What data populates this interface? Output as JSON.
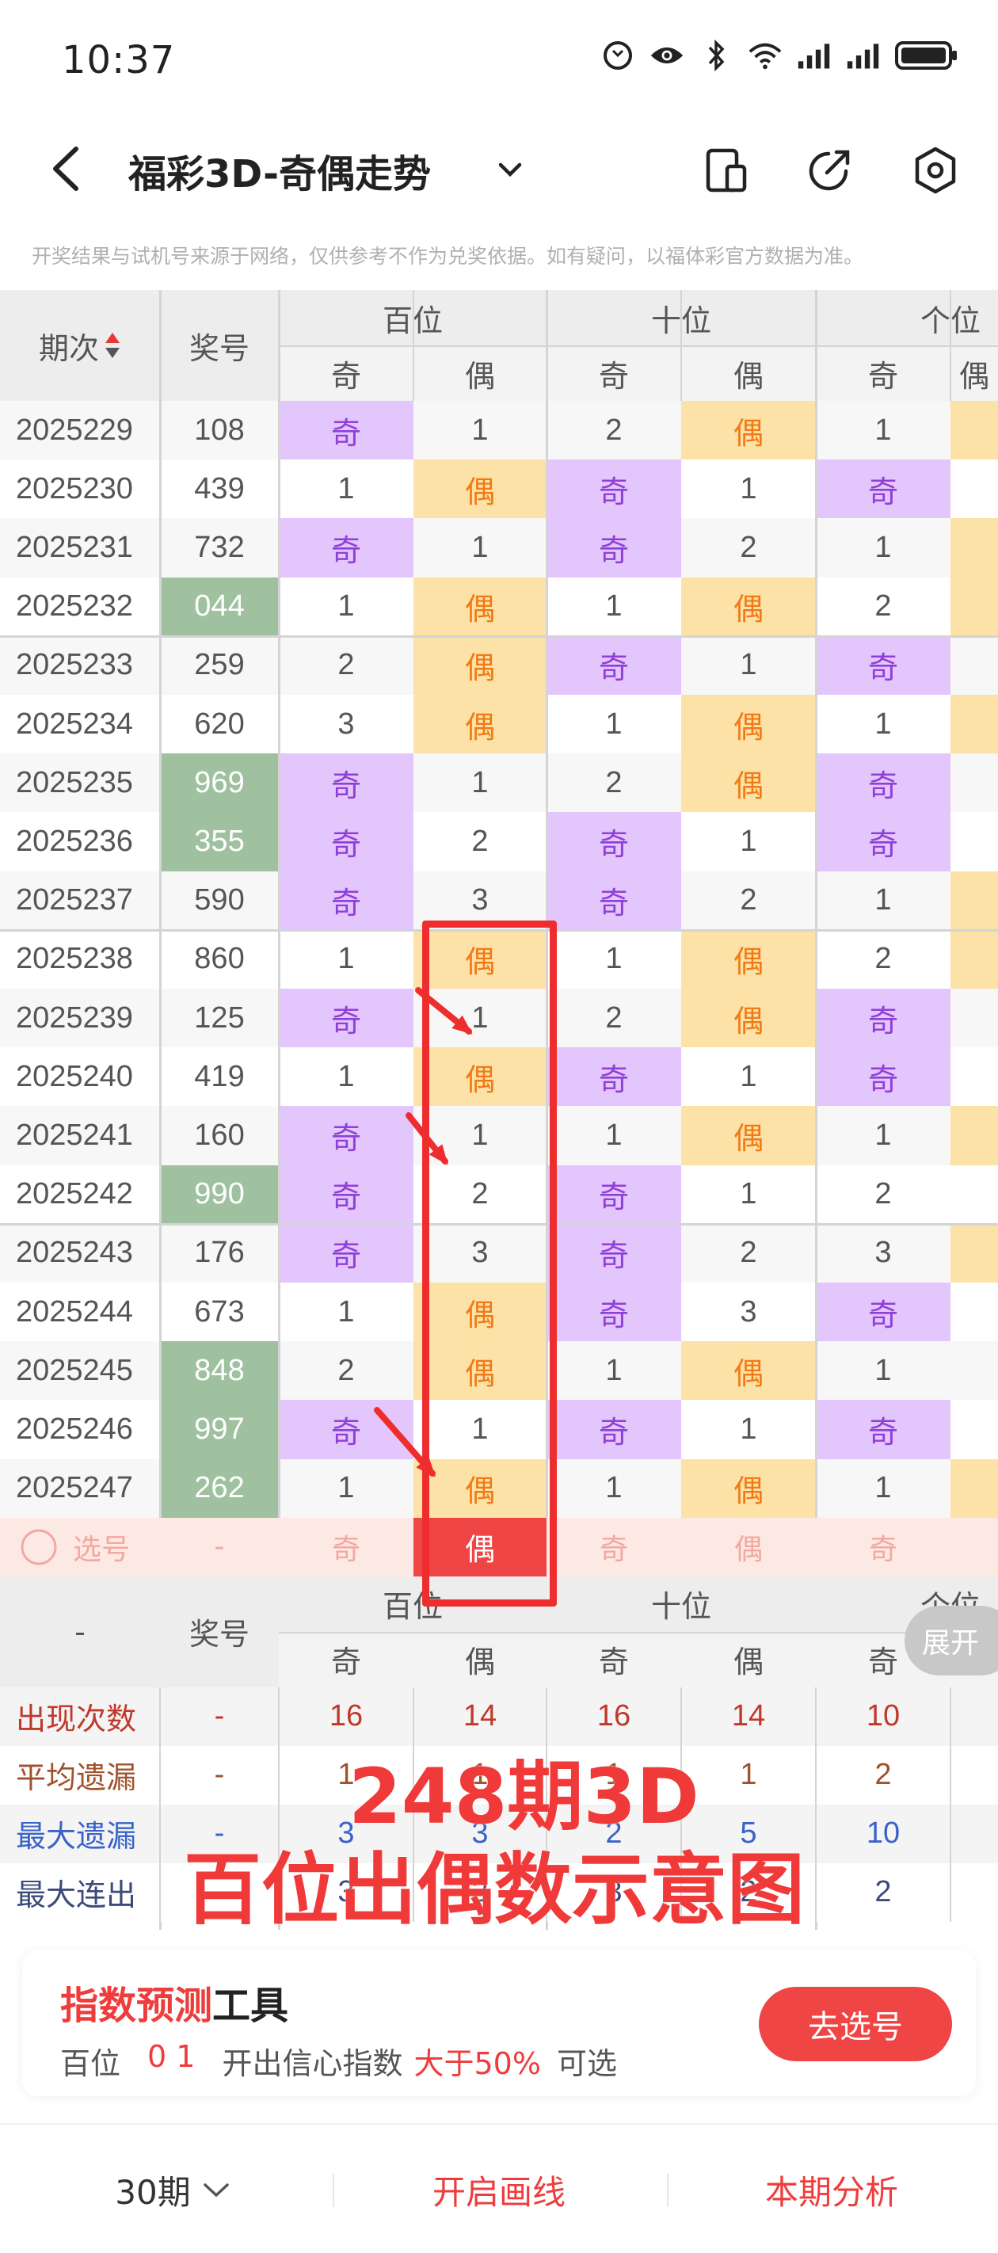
{
  "status": {
    "time": "10:37"
  },
  "header": {
    "title": "福彩3D-奇偶走势"
  },
  "disclaimer": "开奖结果与试机号来源于网络，仅供参考不作为兑奖依据。如有疑问，以福体彩官方数据为准。",
  "table": {
    "col_period": "期次",
    "col_prize": "奖号",
    "groups": [
      "百位",
      "十位",
      "个位"
    ],
    "sub_odd": "奇",
    "sub_even": "偶",
    "rows": [
      {
        "period": "2025229",
        "prize": "108",
        "green": false,
        "cells": [
          "奇",
          "1",
          "2",
          "偶",
          "1"
        ]
      },
      {
        "period": "2025230",
        "prize": "439",
        "green": false,
        "cells": [
          "1",
          "偶",
          "奇",
          "1",
          "奇"
        ]
      },
      {
        "period": "2025231",
        "prize": "732",
        "green": false,
        "cells": [
          "奇",
          "1",
          "奇",
          "2",
          "1"
        ]
      },
      {
        "period": "2025232",
        "prize": "044",
        "green": true,
        "cells": [
          "1",
          "偶",
          "1",
          "偶",
          "2"
        ]
      },
      {
        "period": "2025233",
        "prize": "259",
        "green": false,
        "cells": [
          "2",
          "偶",
          "奇",
          "1",
          "奇"
        ]
      },
      {
        "period": "2025234",
        "prize": "620",
        "green": false,
        "cells": [
          "3",
          "偶",
          "1",
          "偶",
          "1"
        ]
      },
      {
        "period": "2025235",
        "prize": "969",
        "green": true,
        "cells": [
          "奇",
          "1",
          "2",
          "偶",
          "奇"
        ]
      },
      {
        "period": "2025236",
        "prize": "355",
        "green": true,
        "cells": [
          "奇",
          "2",
          "奇",
          "1",
          "奇"
        ]
      },
      {
        "period": "2025237",
        "prize": "590",
        "green": false,
        "cells": [
          "奇",
          "3",
          "奇",
          "2",
          "1"
        ]
      },
      {
        "period": "2025238",
        "prize": "860",
        "green": false,
        "cells": [
          "1",
          "偶",
          "1",
          "偶",
          "2"
        ]
      },
      {
        "period": "2025239",
        "prize": "125",
        "green": false,
        "cells": [
          "奇",
          "1",
          "2",
          "偶",
          "奇"
        ]
      },
      {
        "period": "2025240",
        "prize": "419",
        "green": false,
        "cells": [
          "1",
          "偶",
          "奇",
          "1",
          "奇"
        ]
      },
      {
        "period": "2025241",
        "prize": "160",
        "green": false,
        "cells": [
          "奇",
          "1",
          "1",
          "偶",
          "1"
        ]
      },
      {
        "period": "2025242",
        "prize": "990",
        "green": true,
        "cells": [
          "奇",
          "2",
          "奇",
          "1",
          "2"
        ]
      },
      {
        "period": "2025243",
        "prize": "176",
        "green": false,
        "cells": [
          "奇",
          "3",
          "奇",
          "2",
          "3"
        ]
      },
      {
        "period": "2025244",
        "prize": "673",
        "green": false,
        "cells": [
          "1",
          "偶",
          "奇",
          "3",
          "奇"
        ]
      },
      {
        "period": "2025245",
        "prize": "848",
        "green": true,
        "cells": [
          "2",
          "偶",
          "1",
          "偶",
          "1"
        ]
      },
      {
        "period": "2025246",
        "prize": "997",
        "green": true,
        "cells": [
          "奇",
          "1",
          "奇",
          "1",
          "奇"
        ]
      },
      {
        "period": "2025247",
        "prize": "262",
        "green": true,
        "cells": [
          "1",
          "偶",
          "1",
          "偶",
          "1"
        ]
      }
    ],
    "select_row": {
      "label": "选号",
      "prize": "-",
      "cells": [
        "奇",
        "偶",
        "奇",
        "偶",
        "奇"
      ],
      "active_index": 1
    },
    "footer_header": {
      "period": "-",
      "prize": "奖号"
    },
    "stats": [
      {
        "label": "出现次数",
        "color": "#c0392b",
        "prize": "-",
        "values": [
          "16",
          "14",
          "16",
          "14",
          "10"
        ]
      },
      {
        "label": "平均遗漏",
        "color": "#a0522d",
        "prize": "-",
        "values": [
          "1",
          "1",
          "1",
          "1",
          "2"
        ]
      },
      {
        "label": "最大遗漏",
        "color": "#3a63c7",
        "prize": "-",
        "values": [
          "3",
          "3",
          "2",
          "5",
          "10"
        ]
      },
      {
        "label": "最大连出",
        "color": "#3a4a7a",
        "prize": "-",
        "values": [
          "3",
          "3",
          "3",
          "2",
          "2"
        ]
      }
    ],
    "expand_label": "展开"
  },
  "annotation": {
    "line1": "248期3D",
    "line2": "百位出偶数示意图"
  },
  "tool": {
    "title_red": "指数预测",
    "title_dark": "工具",
    "pos": "百位",
    "digits": "0 1",
    "mid": "开出信心指数",
    "gt": "大于50%",
    "tail": "可选",
    "button": "去选号"
  },
  "bottom": {
    "periods": "30期",
    "draw": "开启画线",
    "analysis": "本期分析"
  },
  "colors": {
    "odd_bg": "#e3c6fb",
    "even_bg": "#fde2a8",
    "accent": "#ef4545",
    "green": "#9fc19f"
  }
}
